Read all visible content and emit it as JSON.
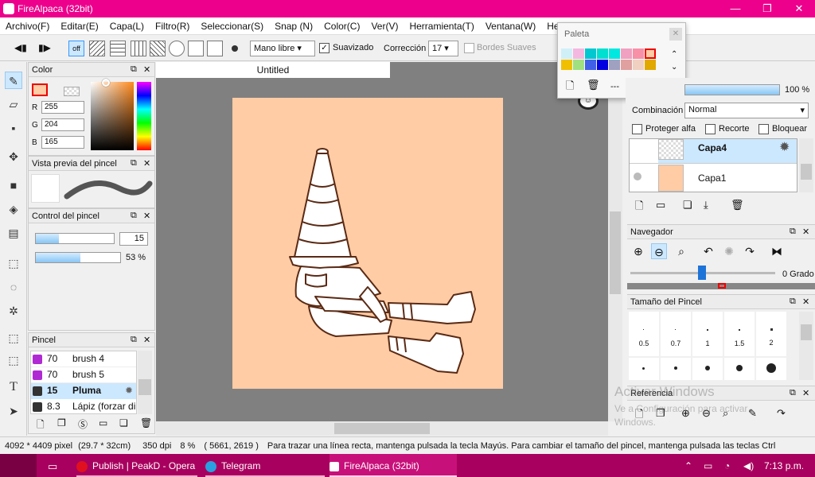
{
  "app": {
    "title": "FireAlpaca (32bit)",
    "win_min": "—",
    "win_max": "❐",
    "win_close": "✕"
  },
  "menu": [
    "Archivo(F)",
    "Editar(E)",
    "Capa(L)",
    "Filtro(R)",
    "Seleccionar(S)",
    "Snap (N)",
    "Color(C)",
    "Ver(V)",
    "Herramienta(T)",
    "Ventana(W)",
    "He"
  ],
  "toolbar": {
    "off": "off",
    "mode": "Mano libre",
    "smooth": "Suavizado",
    "correction_label": "Corrección",
    "correction_value": "17",
    "soft_edges": "Bordes Suaves"
  },
  "color_panel": {
    "title": "Color",
    "r_label": "R",
    "g_label": "G",
    "b_label": "B",
    "r": "255",
    "g": "204",
    "b": "165",
    "current": "#ffcca5"
  },
  "preview_panel": {
    "title": "Vista previa del pincel"
  },
  "brush_control": {
    "title": "Control del pincel",
    "size": "15",
    "opacity": "53 %"
  },
  "brush_panel": {
    "title": "Pincel",
    "items": [
      {
        "size": "70",
        "name": "brush 4",
        "color": "#b02ad4"
      },
      {
        "size": "70",
        "name": "brush 5",
        "color": "#b02ad4"
      },
      {
        "size": "15",
        "name": "Pluma",
        "color": "#222222"
      },
      {
        "size": "8.3",
        "name": "Lápiz (forzar di",
        "color": "#222222"
      }
    ]
  },
  "canvas": {
    "tab": "Untitled",
    "bg": "#ffcca5"
  },
  "palette": {
    "title": "Paleta",
    "rows": [
      [
        "#d0f0f8",
        "#f4b8e0",
        "#00c8d0",
        "#00e0d0",
        "#00e8e0",
        "#f0a0c0",
        "#f890a8",
        "#ffcca5"
      ],
      [
        "#f0c000",
        "#a0e080",
        "#4060e8",
        "#0000e0",
        "#a0a0c0",
        "#e0a0a0",
        "#f0d0c0",
        "#e0a800"
      ]
    ],
    "dash": "---"
  },
  "layers": {
    "opacity": "100 %",
    "blend_label": "Combinación",
    "blend": "Normal",
    "protect": "Proteger alfa",
    "clip": "Recorte",
    "lock": "Bloquear",
    "items": [
      {
        "name": "Capa4"
      },
      {
        "name": "Capa1"
      }
    ]
  },
  "navigator": {
    "title": "Navegador",
    "angle": "0 Grado"
  },
  "brush_size": {
    "title": "Tamaño del Pincel",
    "sizes": [
      "0.5",
      "0.7",
      "1",
      "1.5",
      "2"
    ]
  },
  "reference": {
    "title": "Referencia"
  },
  "watermark": {
    "line1": "Activar Windows",
    "line2": "Ve a Configuración para activar",
    "line3": "Windows."
  },
  "status": {
    "dims": "4092 * 4409 pixel",
    "cm": "(29.7 * 32cm)",
    "dpi": "350 dpi",
    "zoom": "8 %",
    "coords": "( 5661, 2619 )",
    "hint": "Para trazar una línea recta, mantenga pulsada la tecla Mayús. Para cambiar el tamaño del pincel, mantenga pulsada las teclas Ctrl"
  },
  "taskbar": {
    "items": [
      "Publish | PeakD - Opera",
      "Telegram",
      "FireAlpaca (32bit)"
    ],
    "time": "7:13 p.m."
  }
}
